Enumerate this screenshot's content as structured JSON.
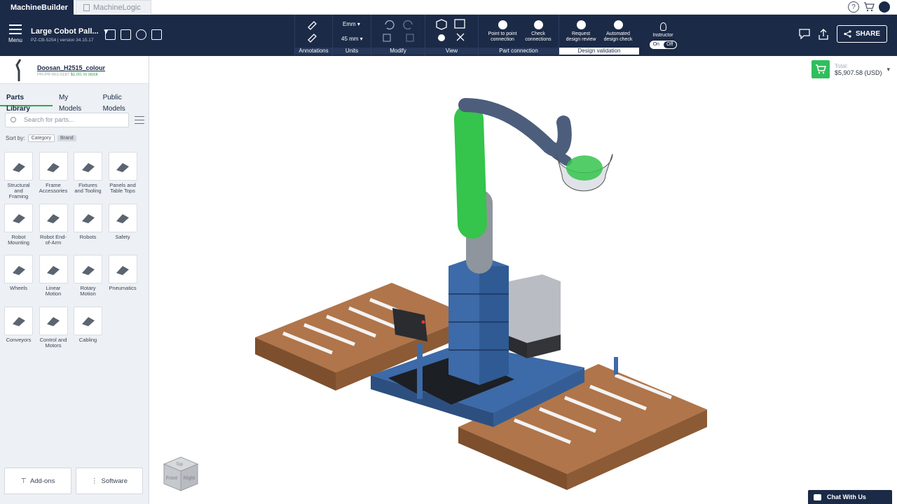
{
  "browser_tabs": [
    {
      "label": "MachineBuilder",
      "active": true
    },
    {
      "label": "MachineLogic",
      "active": false
    }
  ],
  "header_icons": {
    "help": "?",
    "cart": "cart-icon",
    "account": "account-icon"
  },
  "menu": {
    "label": "Menu"
  },
  "project": {
    "title": "Large Cobot Pall...",
    "subtitle": "PZ-CB-5254 | version 34.15.17"
  },
  "toolbar": {
    "groups": [
      {
        "label": "Annotations"
      },
      {
        "label": "Units",
        "unit": "Emm",
        "size": "45 mm"
      },
      {
        "label": "Modify"
      },
      {
        "label": "View"
      },
      {
        "label": "Part connection",
        "items": [
          "Point to point connection",
          "Check connections"
        ]
      },
      {
        "label": "Design validation",
        "items": [
          "Request design review",
          "Automated design check"
        ]
      }
    ],
    "instructor": {
      "label": "Instructor",
      "on": "On",
      "off": "Off"
    },
    "share": "SHARE"
  },
  "selected_part": {
    "name": "Doosan_H2515_colour",
    "sku": "PR-PR-001-0187",
    "price": "$1.00, In stock"
  },
  "library_tabs": [
    "Parts Library",
    "My Models",
    "Public Models"
  ],
  "search": {
    "placeholder": "Search for parts..."
  },
  "sort": {
    "label": "Sort by:",
    "options": [
      "Category",
      "Brand"
    ]
  },
  "categories": [
    "Structural and Framing",
    "Frame Accessories",
    "Fixtures and Tooling",
    "Panels and Table Tops",
    "Robot Mounting",
    "Robot End-of-Arm",
    "Robots",
    "Safety",
    "Wheels",
    "Linear Motion",
    "Rotary Motion",
    "Pneumatics",
    "Conveyors",
    "Control and Motors",
    "Cabling"
  ],
  "bottom_buttons": [
    "Add-ons",
    "Software"
  ],
  "total": {
    "label": "Total:",
    "value": "$5,907.58 (USD)"
  },
  "chat": {
    "label": "Chat With Us"
  },
  "navcube": {
    "front": "Front",
    "right": "Right",
    "top": "Top"
  },
  "colors": {
    "brand_navy": "#1b2a47",
    "accent_green": "#2fbf5b",
    "pallet_brown": "#a0683f",
    "frame_blue": "#3d6aa8"
  }
}
